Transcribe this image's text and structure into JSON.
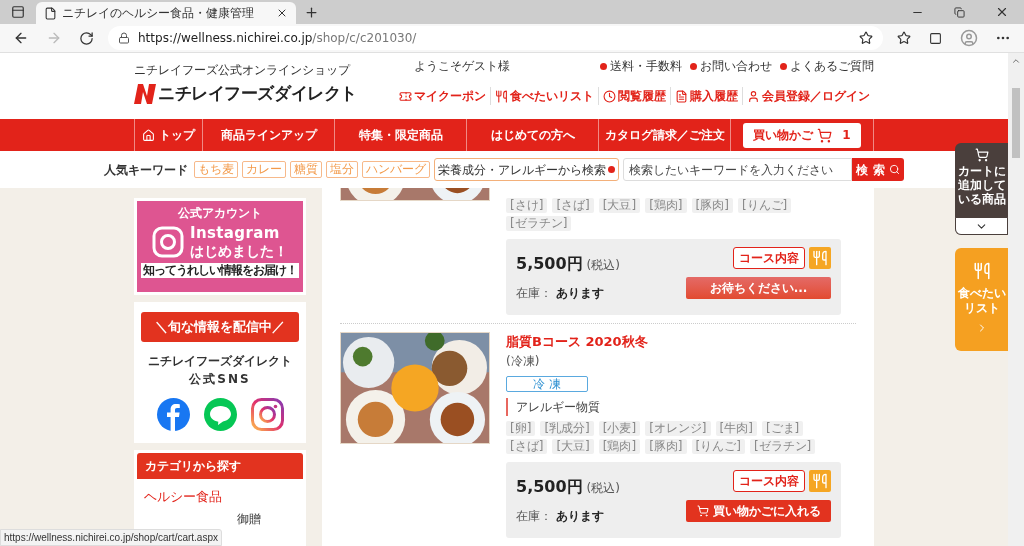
{
  "browser": {
    "tab_title": "ニチレイのヘルシー食品・健康管理",
    "url_host": "https://wellness.nichirei.co.jp",
    "url_path": "/shop/c/c201030/",
    "status_url": "https://wellness.nichirei.co.jp/shop/cart/cart.aspx"
  },
  "header": {
    "shop_caption": "ニチレイフーズ公式オンラインショップ",
    "logo_text": "ニチレイフーズダイレクト",
    "welcome": "ようこそゲスト様",
    "info_links": [
      "送料・手数料",
      "お問い合わせ",
      "よくあるご質問"
    ],
    "user_links": [
      {
        "kind": "coupon",
        "label": "マイクーポン"
      },
      {
        "kind": "wishlist",
        "label": "食べたいリスト"
      },
      {
        "kind": "history",
        "label": "閲覧履歴"
      },
      {
        "kind": "purchases",
        "label": "購入履歴"
      },
      {
        "kind": "account",
        "label": "会員登録／ログイン"
      }
    ]
  },
  "nav": {
    "items": [
      {
        "kind": "home",
        "label": "トップ"
      },
      {
        "kind": "text",
        "label": "商品ラインアップ"
      },
      {
        "kind": "text",
        "label": "特集・限定商品"
      },
      {
        "kind": "text",
        "label": "はじめての方へ"
      },
      {
        "kind": "text",
        "label": "カタログ請求／ご注文"
      }
    ],
    "cart": {
      "label": "買い物かご",
      "count": "1"
    }
  },
  "keywords": {
    "label": "人気キーワード",
    "tags": [
      "もち麦",
      "カレー",
      "糖質",
      "塩分",
      "ハンバーグ"
    ],
    "nutrition_search": "栄養成分・アレルギーから検索",
    "search_placeholder": "検索したいキーワードを入力ください",
    "search_button": "検 索"
  },
  "sidebar": {
    "instagram": {
      "caption": "公式アカウント",
      "title": "Instagram",
      "subtitle": "はじめました！",
      "ribbon": "知ってうれしい情報をお届け！"
    },
    "sns": {
      "banner": "＼旬な情報を配信中／",
      "name": "ニチレイフーズダイレクト",
      "caption": "公式SNS"
    },
    "categories": {
      "title": "カテゴリから探す",
      "items": [
        "ヘルシー食品",
        "御贈"
      ]
    }
  },
  "products": [
    {
      "allergens": [
        "[さけ]",
        "[さば]",
        "[大豆]",
        "[鶏肉]",
        "[豚肉]",
        "[りんご]",
        "[ゼラチン]"
      ],
      "price": "5,500円",
      "tax": "(税込)",
      "course": "コース内容",
      "stock_label": "在庫：",
      "stock": "あります",
      "action": {
        "kind": "waiting",
        "label": "お待ちください..."
      }
    },
    {
      "title": "脂質Bコース 2020秋冬",
      "note": "(冷凍)",
      "badge": "冷 凍",
      "allergen_label": "アレルギー物質",
      "allergens": [
        "[卵]",
        "[乳成分]",
        "[小麦]",
        "[オレンジ]",
        "[牛肉]",
        "[ごま]",
        "[さば]",
        "[大豆]",
        "[鶏肉]",
        "[豚肉]",
        "[りんご]",
        "[ゼラチン]"
      ],
      "price": "5,500円",
      "tax": "(税込)",
      "course": "コース内容",
      "stock_label": "在庫：",
      "stock": "あります",
      "action": {
        "kind": "cart",
        "label": "買い物かごに入れる"
      }
    }
  ],
  "floating": {
    "cart_tab": "カートに追加している商品",
    "wishlist_tab": "食べたいリスト"
  }
}
